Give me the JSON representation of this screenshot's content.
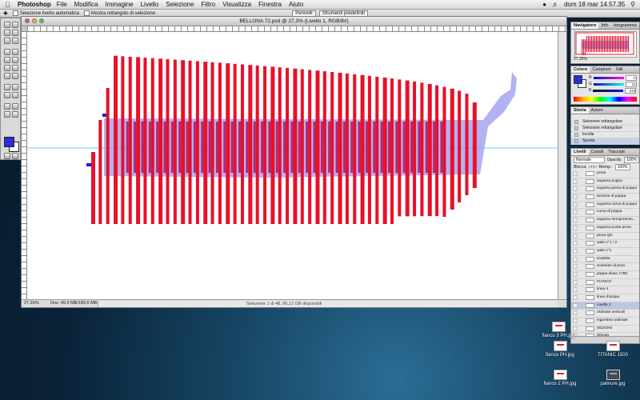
{
  "menubar": {
    "app": "Photoshop",
    "items": [
      "File",
      "Modifica",
      "Immagine",
      "Livello",
      "Selezione",
      "Filtro",
      "Visualizza",
      "Finestra",
      "Aiuto"
    ],
    "clock": "dom 18 mar  14.57.35"
  },
  "options": {
    "auto_select_label": "Selezione livello automatica",
    "bounds_label": "Mostra rettangolo di selezione",
    "brushes_label": "Pennelli",
    "presets_label": "Strumenti predefiniti"
  },
  "document": {
    "title": "BELLONA 72.psd @ 27,3% (Livello 1, RGB/8#)",
    "zoom": "27,26%",
    "doc_size": "Doc: 49,9 MB/189,6 MB",
    "selection_info": "Selezione 1 di 48, 86,12 GB disponibili",
    "colors": {
      "frames": "#e8102a",
      "hull": "#9898ee",
      "guide": "#5fd8e8"
    }
  },
  "navigator": {
    "tabs": [
      "Navigatore",
      "Info",
      "Istogramma"
    ],
    "zoom": "27,26%"
  },
  "color_panel": {
    "tabs": [
      "Colore",
      "Campioni",
      "Stili"
    ],
    "channels": [
      {
        "label": "R",
        "value": "0"
      },
      {
        "label": "G",
        "value": "21"
      },
      {
        "label": "B",
        "value": "213"
      }
    ],
    "foreground": "#2a2dd8"
  },
  "history": {
    "tabs": [
      "Storia",
      "Azioni"
    ],
    "items": [
      "Selezione rettangolare",
      "Selezione rettangolare",
      "Incolla",
      "Sposta"
    ]
  },
  "layers": {
    "tabs": [
      "Livelli",
      "Canali",
      "Tracciati"
    ],
    "blend_mode": "Normale",
    "opacity_label": "Opacità:",
    "opacity": "100%",
    "lock_label": "Blocca:",
    "fill_label": "Riemp.:",
    "fill": "100%",
    "items": [
      "prora",
      "sagoma poppa",
      "sagoma piena di poppa",
      "sezione di poppa",
      "sagoma curva di poppa",
      "curva di poppa",
      "sagoma riempimento...",
      "sagoma ponte prora",
      "prora QD",
      "wale n°1 / 2",
      "wale n°1",
      "scaletta",
      "scalmieri di prua",
      "poppa disan 1780",
      "FIANCO",
      "linea 4",
      "linea d'acqua",
      "Livello 1",
      "ordinate verticali",
      "ingombro ordinate",
      "SEZIONI",
      "Sfondo"
    ],
    "selected": "Livello 1"
  },
  "desktop_icons": [
    {
      "label": "fianco 3 PH.jpg"
    },
    {
      "label": "fianco PH.jpg"
    },
    {
      "label": "TITANIC 1500"
    },
    {
      "label": "fianco 2 PH.jpg"
    },
    {
      "label": "palinure.jpg"
    }
  ]
}
